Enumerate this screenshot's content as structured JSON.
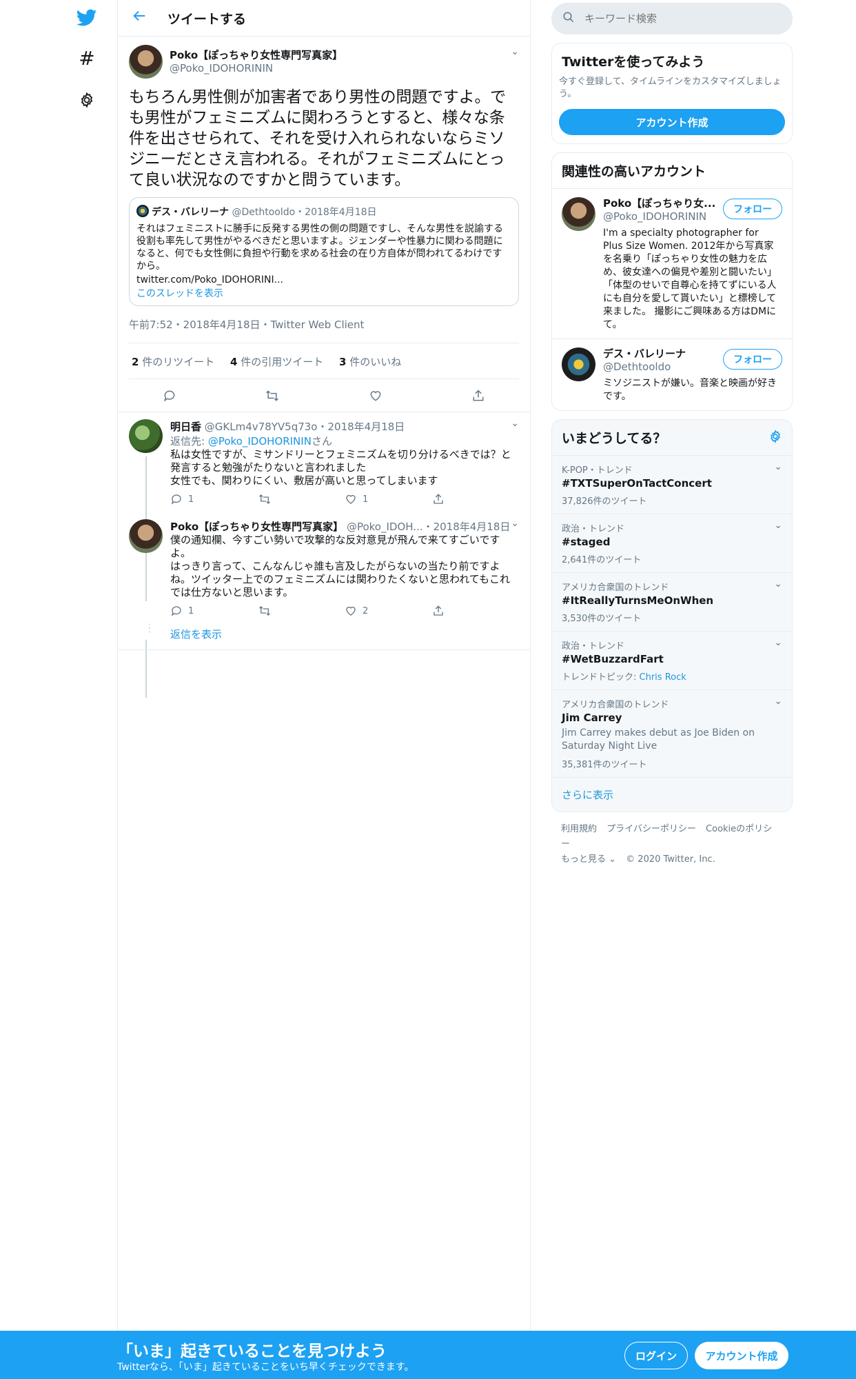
{
  "header": {
    "title": "ツイートする"
  },
  "main_tweet": {
    "name": "Poko【ぽっちゃり女性専門写真家】",
    "handle": "@Poko_IDOHORININ",
    "text": "もちろん男性側が加害者であり男性の問題ですよ。でも男性がフェミニズムに関わろうとすると、様々な条件を出させられて、それを受け入れられないならミソジニーだとさえ言われる。それがフェミニズムにとって良い状況なのですかと問うています。",
    "quote": {
      "name": "デス・バレリーナ",
      "handle": "@Dethtooldo",
      "date": "・2018年4月18日",
      "text": "それはフェミニストに勝手に反発する男性の側の問題ですし、そんな男性を説諭する役割も率先して男性がやるべきだと思いますよ。ジェンダーや性暴力に関わる問題になると、何でも女性側に負担や行動を求める社会の在り方自体が問われてるわけですから。",
      "url": "twitter.com/Poko_IDOHORINI...",
      "thread_link": "このスレッドを表示"
    },
    "meta": "午前7:52・2018年4月18日・Twitter Web Client",
    "stats": {
      "retweets_count": "2",
      "retweets_label": "件のリツイート",
      "quotes_count": "4",
      "quotes_label": "件の引用ツイート",
      "likes_count": "3",
      "likes_label": "件のいいね"
    }
  },
  "replies": [
    {
      "name": "明日香",
      "handle": "@GKLm4v78YV5q73o",
      "date": "・2018年4月18日",
      "reply_to_prefix": "返信先: ",
      "reply_to_handle": "@Poko_IDOHORININ",
      "reply_to_suffix": "さん",
      "line1": "私は女性ですが、ミサンドリーとフェミニズムを切り分けるべきでは？と発言すると勉強がたりないと言われました",
      "line2": "女性でも、関わりにくい、敷居が高いと思ってしまいます",
      "reply_count": "1",
      "retweet_count": "",
      "like_count": "1"
    },
    {
      "name": "Poko【ぽっちゃり女性専門写真家】",
      "handle": "@Poko_IDOH...",
      "date": "・2018年4月18日",
      "line1": "僕の通知欄、今すごい勢いで攻撃的な反対意見が飛んで来てすごいですよ。",
      "line2": "はっきり言って、こんなんじゃ誰も言及したがらないの当たり前ですよね。ツイッター上でのフェミニズムには関わりたくないと思われてもこれでは仕方ないと思います。",
      "reply_count": "1",
      "retweet_count": "",
      "like_count": "2"
    }
  ],
  "show_replies": "返信を表示",
  "sidebar": {
    "search_placeholder": "キーワード検索",
    "signup_card": {
      "title": "Twitterを使ってみよう",
      "desc": "今すぐ登録して、タイムラインをカスタマイズしましょう。",
      "button": "アカウント作成"
    },
    "related": {
      "title": "関連性の高いアカウント",
      "accounts": [
        {
          "name": "Poko【ぽっちゃり女...",
          "handle": "@Poko_IDOHORININ",
          "bio": "I'm a specialty photographer for Plus Size Women. 2012年から写真家を名乗り「ぽっちゃり女性の魅力を広め、彼女達への偏見や差別と闘いたい」「体型のせいで自尊心を持てずにいる人にも自分を愛して貰いたい」と標榜して来ました。 撮影にご興味ある方はDMにて。",
          "follow": "フォロー"
        },
        {
          "name": "デス・バレリーナ",
          "handle": "@Dethtooldo",
          "bio": "ミソジニストが嫌い。音楽と映画が好きです。",
          "follow": "フォロー"
        }
      ]
    },
    "trends": {
      "title": "いまどうしてる？",
      "items": [
        {
          "cat": "K-POP・トレンド",
          "title": "#TXTSuperOnTactConcert",
          "count": "37,826件のツイート"
        },
        {
          "cat": "政治・トレンド",
          "title": "#staged",
          "count": "2,641件のツイート"
        },
        {
          "cat": "アメリカ合衆国のトレンド",
          "title": "#ItReallyTurnsMeOnWhen",
          "count": "3,530件のツイート"
        },
        {
          "cat": "政治・トレンド",
          "title": "#WetBuzzardFart",
          "topic_prefix": "トレンドトピック: ",
          "topic": "Chris Rock"
        },
        {
          "cat": "アメリカ合衆国のトレンド",
          "title": "Jim Carrey",
          "desc": "Jim Carrey makes debut as Joe Biden on Saturday Night Live",
          "count": "35,381件のツイート"
        }
      ],
      "more": "さらに表示"
    },
    "footer": {
      "terms": "利用規約",
      "privacy": "プライバシーポリシー",
      "cookie": "Cookieのポリシー",
      "more": "もっと見る ⌄",
      "copyright": "© 2020 Twitter, Inc."
    }
  },
  "bottom": {
    "headline": "「いま」起きていることを見つけよう",
    "sub": "Twitterなら、「いま」起きていることをいち早くチェックできます。",
    "login": "ログイン",
    "signup": "アカウント作成"
  },
  "colors": {
    "accent": "#1da1f2",
    "border": "#e6ecf0",
    "muted": "#657786"
  }
}
